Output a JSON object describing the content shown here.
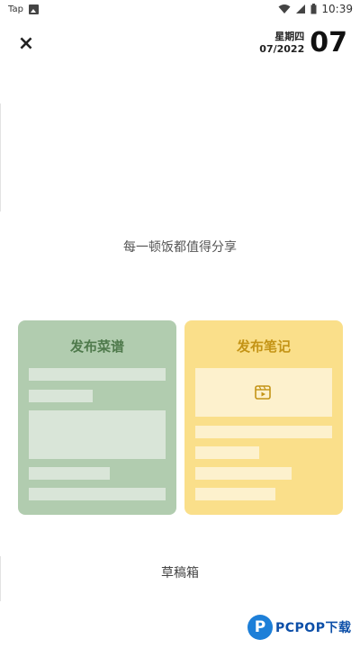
{
  "status_bar": {
    "app_label": "Tap",
    "time": "10:39",
    "icons": [
      "image-icon",
      "wifi-icon",
      "signal-icon",
      "battery-icon"
    ]
  },
  "header": {
    "close_icon": "×",
    "weekday": "星期四",
    "month_year": "07/2022",
    "day": "07"
  },
  "slogan": "每一顿饭都值得分享",
  "cards": {
    "recipe": {
      "title": "发布菜谱",
      "bg_color": "#b1ccaf",
      "title_color": "#4f7a4c"
    },
    "note": {
      "title": "发布笔记",
      "bg_color": "#fadf8a",
      "title_color": "#c49416"
    }
  },
  "drafts_label": "草稿箱",
  "watermark": {
    "mark": "P",
    "text": "PCPOP下载"
  }
}
